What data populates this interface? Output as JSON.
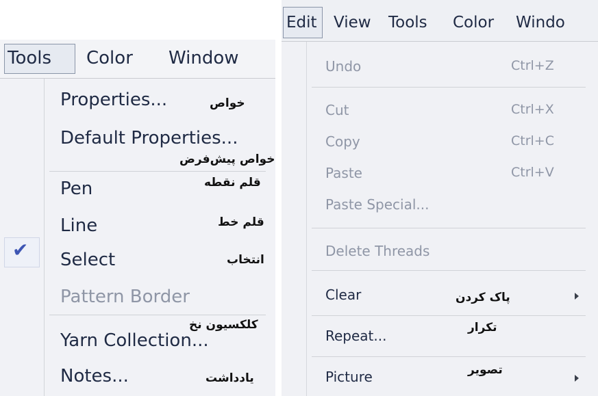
{
  "left_menu": {
    "menubar": [
      "Tools",
      "Color",
      "Window"
    ],
    "items": [
      {
        "label": "Properties...",
        "fa": "خواص"
      },
      {
        "label": "Default Properties...",
        "fa": "خواص پیش‌فرض"
      },
      {
        "label": "Pen",
        "fa": "قلم نقطه"
      },
      {
        "label": "Line",
        "fa": "قلم خط",
        "checked": true,
        "check_glyph": "✔"
      },
      {
        "label": "Select",
        "fa": "انتخاب"
      },
      {
        "label": "Pattern Border",
        "disabled": true
      },
      {
        "label": "Yarn Collection...",
        "fa": "کلکسیون نخ"
      },
      {
        "label": "Notes...",
        "fa": "یادداشت"
      }
    ]
  },
  "right_menu": {
    "menubar": [
      "Edit",
      "View",
      "Tools",
      "Color",
      "Windo"
    ],
    "items": [
      {
        "label": "Undo",
        "shortcut": "Ctrl+Z",
        "disabled": true
      },
      {
        "label": "Cut",
        "shortcut": "Ctrl+X",
        "disabled": true
      },
      {
        "label": "Copy",
        "shortcut": "Ctrl+C",
        "disabled": true
      },
      {
        "label": "Paste",
        "shortcut": "Ctrl+V",
        "disabled": true
      },
      {
        "label": "Paste Special...",
        "disabled": true
      },
      {
        "label": "Delete Threads",
        "disabled": true
      },
      {
        "label": "Clear",
        "fa": "پاک کردن",
        "submenu": true
      },
      {
        "label": "Repeat...",
        "fa": "تکرار"
      },
      {
        "label": "Picture",
        "fa": "تصویر",
        "submenu": true
      }
    ]
  },
  "colors": {
    "checkmark": "#3d55b3",
    "disabled_text": "#8f96a6",
    "text": "#1f2a44"
  }
}
